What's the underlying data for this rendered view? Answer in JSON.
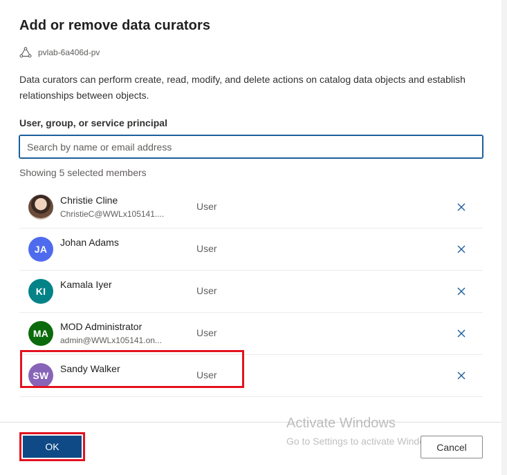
{
  "dialog": {
    "title": "Add or remove data curators",
    "account_name": "pvlab-6a406d-pv",
    "description": "Data curators can perform create, read, modify, and delete actions on catalog data objects and establish relationships between objects.",
    "field_label": "User, group, or service principal",
    "search_placeholder": "Search by name or email address",
    "search_value": "",
    "showing_text": "Showing 5 selected members"
  },
  "members": [
    {
      "name": "Christie Cline",
      "email": "ChristieC@WWLx105141....",
      "type": "User",
      "initials": "",
      "avatar_color": "photo"
    },
    {
      "name": "Johan Adams",
      "email": "",
      "type": "User",
      "initials": "JA",
      "avatar_color": "#4f6bed"
    },
    {
      "name": "Kamala Iyer",
      "email": "",
      "type": "User",
      "initials": "KI",
      "avatar_color": "#038387"
    },
    {
      "name": "MOD Administrator",
      "email": "admin@WWLx105141.on...",
      "type": "User",
      "initials": "MA",
      "avatar_color": "#0b6a0b"
    },
    {
      "name": "Sandy Walker",
      "email": "",
      "type": "User",
      "initials": "SW",
      "avatar_color": "#8764b8"
    }
  ],
  "footer": {
    "ok_label": "OK",
    "cancel_label": "Cancel"
  },
  "watermark": {
    "title": "Activate Windows",
    "subtitle": "Go to Settings to activate Windows."
  },
  "colors": {
    "primary": "#0f4a86",
    "highlight": "#e3121f",
    "remove_icon": "#1b5e9c"
  },
  "icons": {
    "account": "purview-account-icon",
    "remove": "close-icon"
  }
}
